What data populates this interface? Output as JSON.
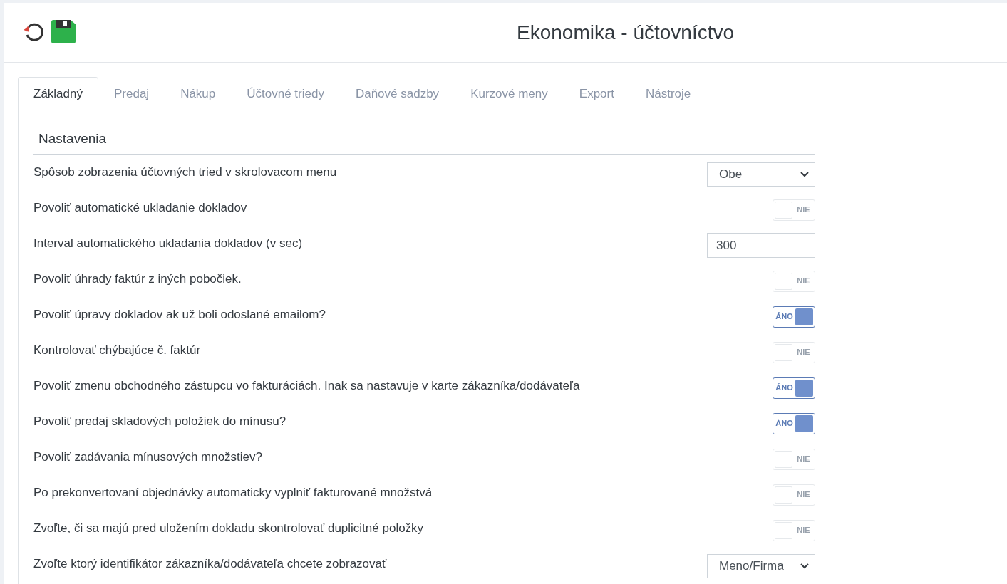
{
  "header": {
    "title": "Ekonomika - účtovníctvo"
  },
  "tabs": [
    {
      "label": "Základný",
      "selected": true
    },
    {
      "label": "Predaj",
      "selected": false
    },
    {
      "label": "Nákup",
      "selected": false
    },
    {
      "label": "Účtovné triedy",
      "selected": false
    },
    {
      "label": "Daňové sadzby",
      "selected": false
    },
    {
      "label": "Kurzové meny",
      "selected": false
    },
    {
      "label": "Export",
      "selected": false
    },
    {
      "label": "Nástroje",
      "selected": false
    }
  ],
  "section": {
    "title": "Nastavenia"
  },
  "settings": [
    {
      "kind": "select",
      "label": "Spôsob zobrazenia účtovných tried v skrolovacom menu",
      "value": "Obe"
    },
    {
      "kind": "toggle",
      "label": "Povoliť automatické ukladanie dokladov",
      "on": false,
      "state_text": "NIE"
    },
    {
      "kind": "input",
      "label": "Interval automatického ukladania dokladov (v sec)",
      "value": "300"
    },
    {
      "kind": "toggle",
      "label": "Povoliť úhrady faktúr z iných pobočiek.",
      "on": false,
      "state_text": "NIE"
    },
    {
      "kind": "toggle",
      "label": "Povoliť úpravy dokladov ak už boli odoslané emailom?",
      "on": true,
      "state_text": "ÁNO"
    },
    {
      "kind": "toggle",
      "label": "Kontrolovať chýbajúce č. faktúr",
      "on": false,
      "state_text": "NIE"
    },
    {
      "kind": "toggle",
      "label": "Povoliť zmenu obchodného zástupcu vo fakturáciách. Inak sa nastavuje v karte zákazníka/dodávateľa",
      "on": true,
      "state_text": "ÁNO"
    },
    {
      "kind": "toggle",
      "label": "Povoliť predaj skladových položiek do mínusu?",
      "on": true,
      "state_text": "ÁNO"
    },
    {
      "kind": "toggle",
      "label": "Povoliť zadávania mínusových množstiev?",
      "on": false,
      "state_text": "NIE"
    },
    {
      "kind": "toggle",
      "label": "Po prekonvertovaní objednávky automaticky vyplniť fakturované množstvá",
      "on": false,
      "state_text": "NIE"
    },
    {
      "kind": "toggle",
      "label": "Zvoľte, či sa majú pred uložením dokladu skontrolovať duplicitné položky",
      "on": false,
      "state_text": "NIE"
    },
    {
      "kind": "select",
      "label": "Zvoľte ktorý identifikátor zákazníka/dodávateľa chcete zobrazovať",
      "value": "Meno/Firma"
    }
  ]
}
